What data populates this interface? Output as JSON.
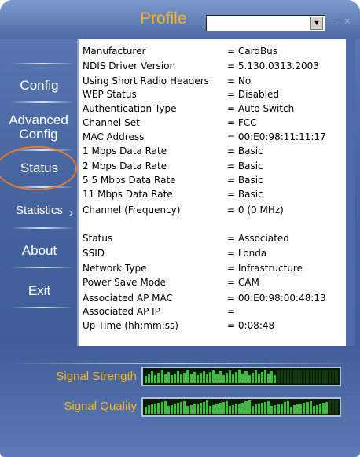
{
  "window": {
    "title": "Profile",
    "profile_value": "",
    "dropdown_glyph": "▼",
    "minimize_glyph": "–",
    "close_glyph": "×"
  },
  "sidebar": {
    "items": [
      {
        "label": "Config"
      },
      {
        "label": "Advanced Config"
      },
      {
        "label": "Status"
      },
      {
        "label": "Statistics"
      },
      {
        "label": "About"
      },
      {
        "label": "Exit"
      }
    ],
    "selected": "Status",
    "statistics_arrow": "›"
  },
  "status": {
    "rows": [
      {
        "label": "Manufacturer",
        "value": "= CardBus"
      },
      {
        "label": "NDIS Driver Version",
        "value": "= 5.130.0313.2003"
      },
      {
        "label": "Using Short Radio Headers",
        "value": "= No"
      },
      {
        "label": "WEP Status",
        "value": "= Disabled"
      },
      {
        "label": "Authentication Type",
        "value": "= Auto Switch"
      },
      {
        "label": "Channel Set",
        "value": "= FCC"
      },
      {
        "label": "MAC Address",
        "value": "= 00:E0:98:11:11:17"
      },
      {
        "label": "1 Mbps Data Rate",
        "value": "= Basic"
      },
      {
        "label": "2 Mbps Data Rate",
        "value": "= Basic"
      },
      {
        "label": "5.5 Mbps Data Rate",
        "value": "= Basic"
      },
      {
        "label": "11 Mbps Data Rate",
        "value": "= Basic"
      },
      {
        "label": "Channel (Frequency)",
        "value": "= 0 (0 MHz)"
      },
      {
        "label": "Status",
        "value": "= Associated"
      },
      {
        "label": "SSID",
        "value": "= Londa"
      },
      {
        "label": "Network Type",
        "value": "= Infrastructure"
      },
      {
        "label": "Power Save Mode",
        "value": "= CAM"
      },
      {
        "label": "Associated AP MAC",
        "value": "= 00:E0:98:00:48:13"
      },
      {
        "label": "Associated AP IP",
        "value": "="
      },
      {
        "label": "Up Time (hh:mm:ss)",
        "value": "= 0:08:48"
      }
    ]
  },
  "meters": {
    "signal_strength": {
      "label": "Signal Strength",
      "level": 0.68
    },
    "signal_quality": {
      "label": "Signal Quality",
      "level": 0.95
    }
  },
  "colors": {
    "accent": "#ffb31a",
    "frame": "#46659f",
    "meter_on": "#38c038",
    "highlight_ring": "#e77a2a"
  }
}
